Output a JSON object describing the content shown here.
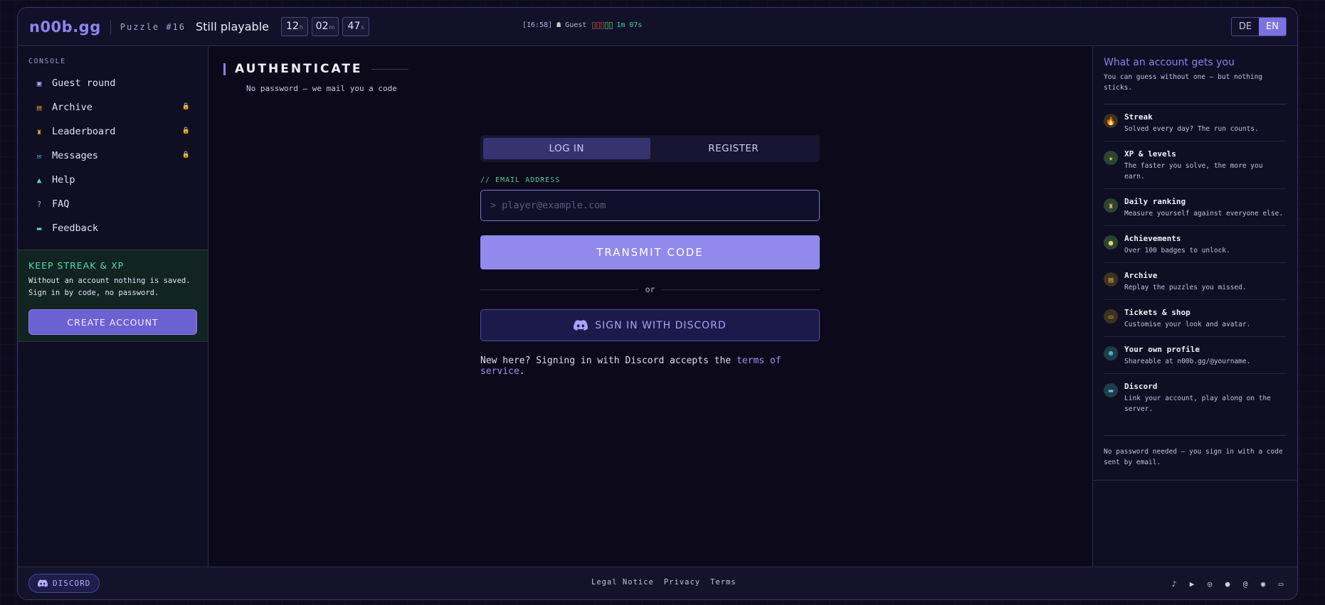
{
  "header": {
    "logo": "n00b.gg",
    "puzzle": "Puzzle #16",
    "state": "Still playable",
    "timer": [
      {
        "value": "12",
        "unit": "h"
      },
      {
        "value": "02",
        "unit": "m"
      },
      {
        "value": "47",
        "unit": "s"
      }
    ],
    "clock": "[16:58]",
    "user": "Guest",
    "session_time": "1m 07s",
    "lang": {
      "de": "DE",
      "en": "EN",
      "active": "EN"
    }
  },
  "sidebar": {
    "section": "CONSOLE",
    "items": [
      {
        "label": "Guest round",
        "icon": "grid-icon",
        "locked": false
      },
      {
        "label": "Archive",
        "icon": "box-icon",
        "locked": true
      },
      {
        "label": "Leaderboard",
        "icon": "trophy-icon",
        "locked": true
      },
      {
        "label": "Messages",
        "icon": "inbox-icon",
        "locked": true
      },
      {
        "label": "Help",
        "icon": "bell-icon",
        "locked": false
      },
      {
        "label": "FAQ",
        "icon": "question-icon",
        "locked": false
      },
      {
        "label": "Feedback",
        "icon": "chat-icon",
        "locked": false
      }
    ],
    "promo": {
      "title": "KEEP STREAK & XP",
      "text": "Without an account nothing is saved. Sign in by code, no password.",
      "button": "CREATE ACCOUNT"
    }
  },
  "main": {
    "title": "AUTHENTICATE",
    "subtitle": "No password — we mail you a code",
    "tabs": {
      "login": "LOG IN",
      "register": "REGISTER",
      "active": "login"
    },
    "email_label": "// EMAIL ADDRESS",
    "email_prompt": ">",
    "email_placeholder": "player@example.com",
    "transmit": "TRANSMIT CODE",
    "or": "or",
    "discord": "SIGN IN WITH DISCORD",
    "terms_prefix": "New here? Signing in with Discord accepts the",
    "terms_link": "terms of service",
    "terms_suffix": "."
  },
  "panel": {
    "title": "What an account gets you",
    "subtitle": "You can guess without one — but nothing sticks.",
    "features": [
      {
        "title": "Streak",
        "desc": "Solved every day? The run counts.",
        "icon": "fire-icon"
      },
      {
        "title": "XP & levels",
        "desc": "The faster you solve, the more you earn.",
        "icon": "star-icon"
      },
      {
        "title": "Daily ranking",
        "desc": "Measure yourself against everyone else.",
        "icon": "trophy-icon"
      },
      {
        "title": "Achievements",
        "desc": "Over 100 badges to unlock.",
        "icon": "medal-icon"
      },
      {
        "title": "Archive",
        "desc": "Replay the puzzles you missed.",
        "icon": "box-icon"
      },
      {
        "title": "Tickets & shop",
        "desc": "Customise your look and avatar.",
        "icon": "ticket-icon"
      },
      {
        "title": "Your own profile",
        "desc": "Shareable at n00b.gg/@yourname.",
        "icon": "people-icon"
      },
      {
        "title": "Discord",
        "desc": "Link your account, play along on the server.",
        "icon": "chat-icon"
      }
    ],
    "footnote": "No password needed — you sign in with a code sent by email."
  },
  "footer": {
    "discord": "DISCORD",
    "links": [
      "Legal Notice",
      "Privacy",
      "Terms"
    ],
    "social": [
      "tiktok-icon",
      "youtube-icon",
      "instagram-icon",
      "reddit-icon",
      "threads-icon",
      "discord-icon",
      "gamepad-icon"
    ]
  },
  "colors": {
    "accent": "#8b80ee",
    "button": "#9189ec",
    "success": "#4fe0a6",
    "lock": "#e0a53c"
  }
}
